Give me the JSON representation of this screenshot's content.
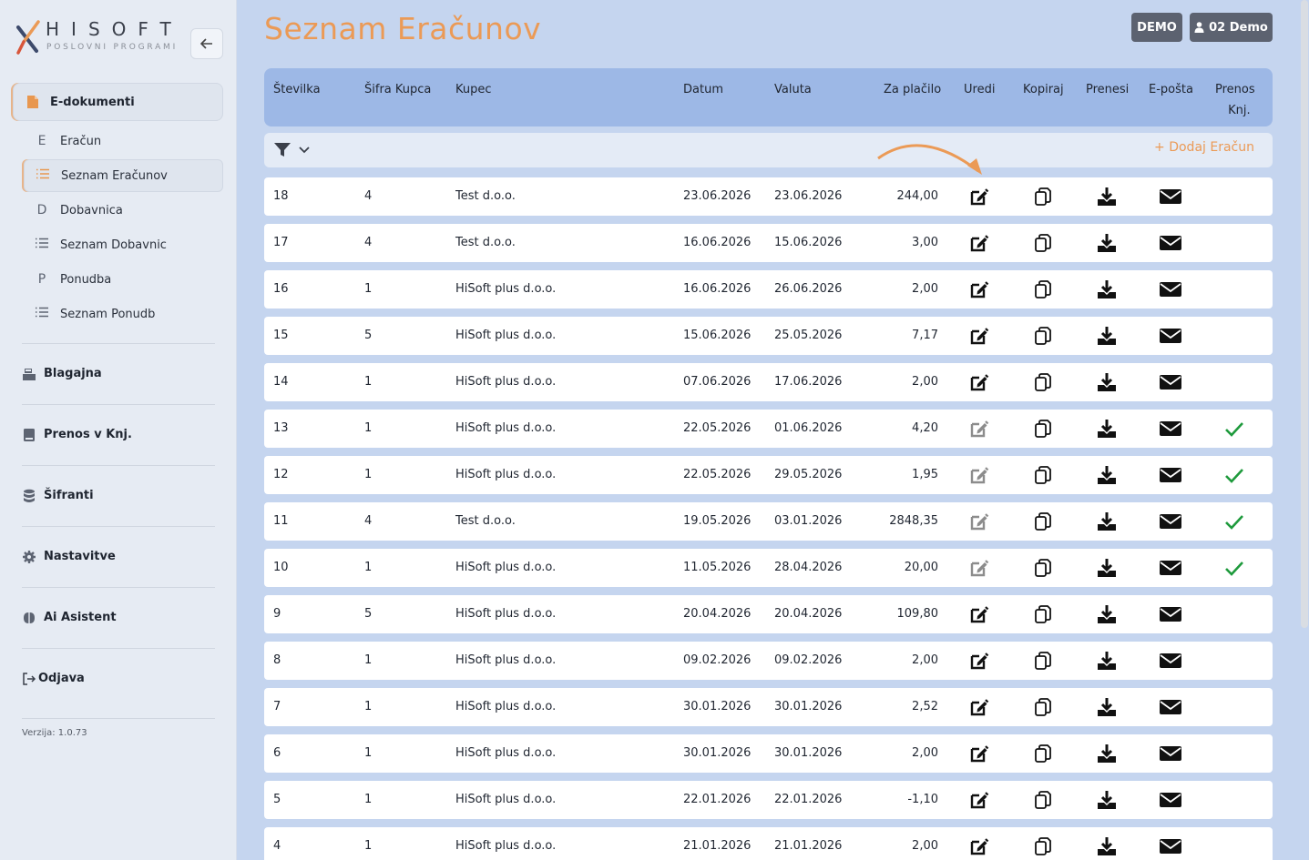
{
  "brand": {
    "name": "HISOFT",
    "tagline": "POSLOVNI PROGRAMI"
  },
  "sidebar": {
    "group": {
      "label": "E-dokumenti"
    },
    "items": [
      {
        "glyph": "E",
        "label": "Eračun"
      },
      {
        "glyph": "list",
        "label": "Seznam Eračunov"
      },
      {
        "glyph": "D",
        "label": "Dobavnica"
      },
      {
        "glyph": "list",
        "label": "Seznam Dobavnic"
      },
      {
        "glyph": "P",
        "label": "Ponudba"
      },
      {
        "glyph": "list",
        "label": "Seznam Ponudb"
      }
    ],
    "sections": [
      {
        "label": "Blagajna",
        "icon": "cash-register-icon"
      },
      {
        "label": "Prenos v Knj.",
        "icon": "book-icon"
      },
      {
        "label": "Šifranti",
        "icon": "database-icon"
      },
      {
        "label": "Nastavitve",
        "icon": "gear-icon"
      },
      {
        "label": "Ai Asistent",
        "icon": "brain-icon"
      },
      {
        "label": "Odjava",
        "icon": "logout-icon"
      }
    ],
    "version": "Verzija: 1.0.73"
  },
  "page": {
    "title": "Seznam Eračunov"
  },
  "badges": {
    "demo": "DEMO",
    "user": "02 Demo"
  },
  "table": {
    "headers": {
      "stevilka": "Številka",
      "sifra": "Šifra Kupca",
      "kupec": "Kupec",
      "datum": "Datum",
      "valuta": "Valuta",
      "zaplacilo": "Za plačilo",
      "uredi": "Uredi",
      "kopiraj": "Kopiraj",
      "prenesi": "Prenesi",
      "eposta": "E-pošta",
      "prenos_1": "Prenos",
      "prenos_2": "Knj."
    },
    "add_label": "+ Dodaj Eračun",
    "rows": [
      {
        "stevilka": "18",
        "sifra": "4",
        "kupec": "Test d.o.o.",
        "datum": "23.06.2026",
        "valuta": "23.06.2026",
        "znesek": "244,00",
        "prenos": false
      },
      {
        "stevilka": "17",
        "sifra": "4",
        "kupec": "Test d.o.o.",
        "datum": "16.06.2026",
        "valuta": "15.06.2026",
        "znesek": "3,00",
        "prenos": false
      },
      {
        "stevilka": "16",
        "sifra": "1",
        "kupec": "HiSoft plus d.o.o.",
        "datum": "16.06.2026",
        "valuta": "26.06.2026",
        "znesek": "2,00",
        "prenos": false
      },
      {
        "stevilka": "15",
        "sifra": "5",
        "kupec": "HiSoft plus d.o.o.",
        "datum": "15.06.2026",
        "valuta": "25.05.2026",
        "znesek": "7,17",
        "prenos": false
      },
      {
        "stevilka": "14",
        "sifra": "1",
        "kupec": "HiSoft plus d.o.o.",
        "datum": "07.06.2026",
        "valuta": "17.06.2026",
        "znesek": "2,00",
        "prenos": false
      },
      {
        "stevilka": "13",
        "sifra": "1",
        "kupec": "HiSoft plus d.o.o.",
        "datum": "22.05.2026",
        "valuta": "01.06.2026",
        "znesek": "4,20",
        "prenos": true
      },
      {
        "stevilka": "12",
        "sifra": "1",
        "kupec": "HiSoft plus d.o.o.",
        "datum": "22.05.2026",
        "valuta": "29.05.2026",
        "znesek": "1,95",
        "prenos": true
      },
      {
        "stevilka": "11",
        "sifra": "4",
        "kupec": "Test d.o.o.",
        "datum": "19.05.2026",
        "valuta": "03.01.2026",
        "znesek": "2848,35",
        "prenos": true
      },
      {
        "stevilka": "10",
        "sifra": "1",
        "kupec": "HiSoft plus d.o.o.",
        "datum": "11.05.2026",
        "valuta": "28.04.2026",
        "znesek": "20,00",
        "prenos": true
      },
      {
        "stevilka": "9",
        "sifra": "5",
        "kupec": "HiSoft plus d.o.o.",
        "datum": "20.04.2026",
        "valuta": "20.04.2026",
        "znesek": "109,80",
        "prenos": false
      },
      {
        "stevilka": "8",
        "sifra": "1",
        "kupec": "HiSoft plus d.o.o.",
        "datum": "09.02.2026",
        "valuta": "09.02.2026",
        "znesek": "2,00",
        "prenos": false
      },
      {
        "stevilka": "7",
        "sifra": "1",
        "kupec": "HiSoft plus d.o.o.",
        "datum": "30.01.2026",
        "valuta": "30.01.2026",
        "znesek": "2,52",
        "prenos": false
      },
      {
        "stevilka": "6",
        "sifra": "1",
        "kupec": "HiSoft plus d.o.o.",
        "datum": "30.01.2026",
        "valuta": "30.01.2026",
        "znesek": "2,00",
        "prenos": false
      },
      {
        "stevilka": "5",
        "sifra": "1",
        "kupec": "HiSoft plus d.o.o.",
        "datum": "22.01.2026",
        "valuta": "22.01.2026",
        "znesek": "-1,10",
        "prenos": false
      },
      {
        "stevilka": "4",
        "sifra": "1",
        "kupec": "HiSoft plus d.o.o.",
        "datum": "21.01.2026",
        "valuta": "21.01.2026",
        "znesek": "2,00",
        "prenos": false
      }
    ]
  },
  "colors": {
    "accent": "#eb9a56",
    "header": "#9db8e6",
    "check": "#1e9a3c",
    "disabled_icon": "#8c8c8c"
  }
}
